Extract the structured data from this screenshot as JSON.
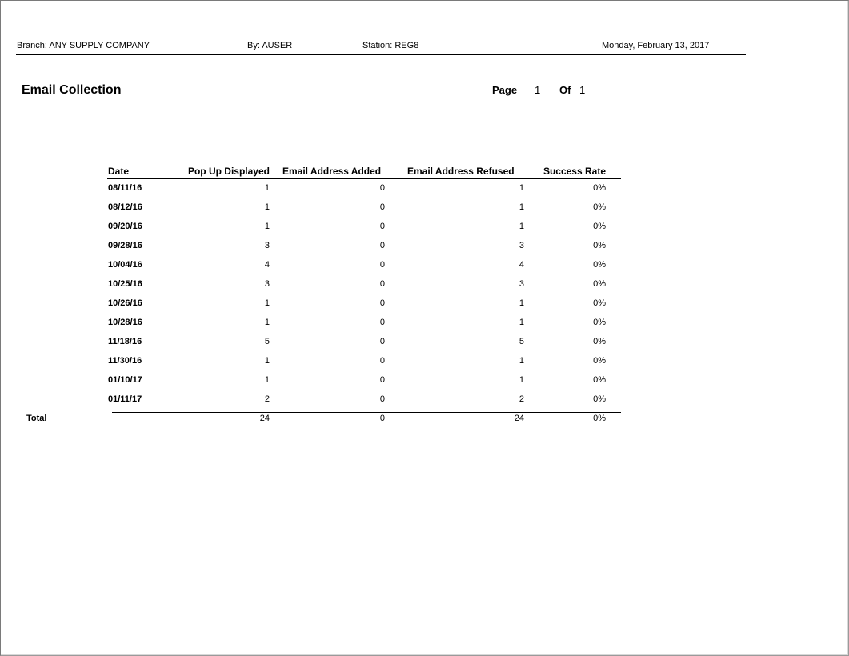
{
  "header": {
    "branch": "Branch: ANY SUPPLY COMPANY",
    "by": "By: AUSER",
    "station": "Station: REG8",
    "date": "Monday, February 13, 2017"
  },
  "report": {
    "title": "Email Collection",
    "page_label": "Page",
    "page_number": "1",
    "of_label": "Of",
    "page_total": "1"
  },
  "table": {
    "columns": [
      "Date",
      "Pop Up Displayed",
      "Email Address Added",
      "Email Address Refused",
      "Success Rate"
    ],
    "rows": [
      [
        "08/11/16",
        "1",
        "0",
        "1",
        "0%"
      ],
      [
        "08/12/16",
        "1",
        "0",
        "1",
        "0%"
      ],
      [
        "09/20/16",
        "1",
        "0",
        "1",
        "0%"
      ],
      [
        "09/28/16",
        "3",
        "0",
        "3",
        "0%"
      ],
      [
        "10/04/16",
        "4",
        "0",
        "4",
        "0%"
      ],
      [
        "10/25/16",
        "3",
        "0",
        "3",
        "0%"
      ],
      [
        "10/26/16",
        "1",
        "0",
        "1",
        "0%"
      ],
      [
        "10/28/16",
        "1",
        "0",
        "1",
        "0%"
      ],
      [
        "11/18/16",
        "5",
        "0",
        "5",
        "0%"
      ],
      [
        "11/30/16",
        "1",
        "0",
        "1",
        "0%"
      ],
      [
        "01/10/17",
        "1",
        "0",
        "1",
        "0%"
      ],
      [
        "01/11/17",
        "2",
        "0",
        "2",
        "0%"
      ]
    ],
    "total": {
      "label": "Total",
      "pop_up_displayed": "24",
      "email_added": "0",
      "email_refused": "24",
      "success_rate": "0%"
    }
  }
}
